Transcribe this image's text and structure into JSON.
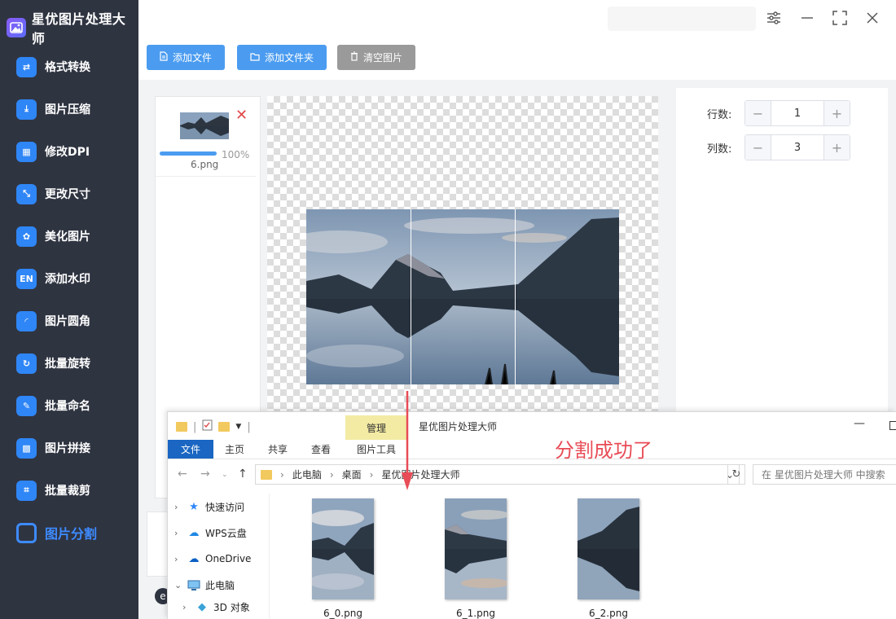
{
  "app": {
    "title": "星优图片处理大师"
  },
  "sidebar": {
    "items": [
      {
        "label": "格式转换",
        "icon": "format-convert-icon",
        "glyph": "⇄"
      },
      {
        "label": "图片压缩",
        "icon": "compress-icon",
        "glyph": "⤓"
      },
      {
        "label": "修改DPI",
        "icon": "dpi-icon",
        "glyph": "▦"
      },
      {
        "label": "更改尺寸",
        "icon": "resize-icon",
        "glyph": "⤡"
      },
      {
        "label": "美化图片",
        "icon": "beautify-icon",
        "glyph": "✿"
      },
      {
        "label": "添加水印",
        "icon": "watermark-icon",
        "glyph": "EN"
      },
      {
        "label": "图片圆角",
        "icon": "round-corner-icon",
        "glyph": "◜"
      },
      {
        "label": "批量旋转",
        "icon": "rotate-icon",
        "glyph": "↻"
      },
      {
        "label": "批量命名",
        "icon": "rename-icon",
        "glyph": "✎"
      },
      {
        "label": "图片拼接",
        "icon": "stitch-icon",
        "glyph": "▩"
      },
      {
        "label": "批量裁剪",
        "icon": "crop-icon",
        "glyph": "⌗"
      },
      {
        "label": "图片分割",
        "icon": "split-icon",
        "glyph": ""
      }
    ],
    "active_index": 11
  },
  "toolbar": {
    "add_file": "添加文件",
    "add_folder": "添加文件夹",
    "clear": "清空图片"
  },
  "thumb": {
    "filename": "6.png",
    "progress_label": "100%",
    "progress": 1.0
  },
  "settings": {
    "rows_label": "行数:",
    "rows_value": "1",
    "cols_label": "列数:",
    "cols_value": "3"
  },
  "explorer": {
    "manage_tab": "管理",
    "window_title": "星优图片处理大师",
    "ribbon_tabs": [
      "文件",
      "主页",
      "共享",
      "查看",
      "图片工具"
    ],
    "success_note": "分割成功了",
    "breadcrumb": [
      "此电脑",
      "桌面",
      "星优图片处理大师"
    ],
    "search_placeholder": "在 星优图片处理大师 中搜索",
    "tree": [
      {
        "label": "快速访问",
        "icon": "star-icon"
      },
      {
        "label": "WPS云盘",
        "icon": "cloud-icon"
      },
      {
        "label": "OneDrive",
        "icon": "onedrive-icon"
      },
      {
        "label": "此电脑",
        "icon": "computer-icon"
      },
      {
        "label": "3D 对象",
        "icon": "3d-objects-icon"
      }
    ],
    "files": [
      "6_0.png",
      "6_1.png",
      "6_2.png"
    ]
  },
  "colors": {
    "accent": "#3d8bff",
    "sidebar_bg": "#2f3441",
    "note_red": "#e84c56"
  }
}
